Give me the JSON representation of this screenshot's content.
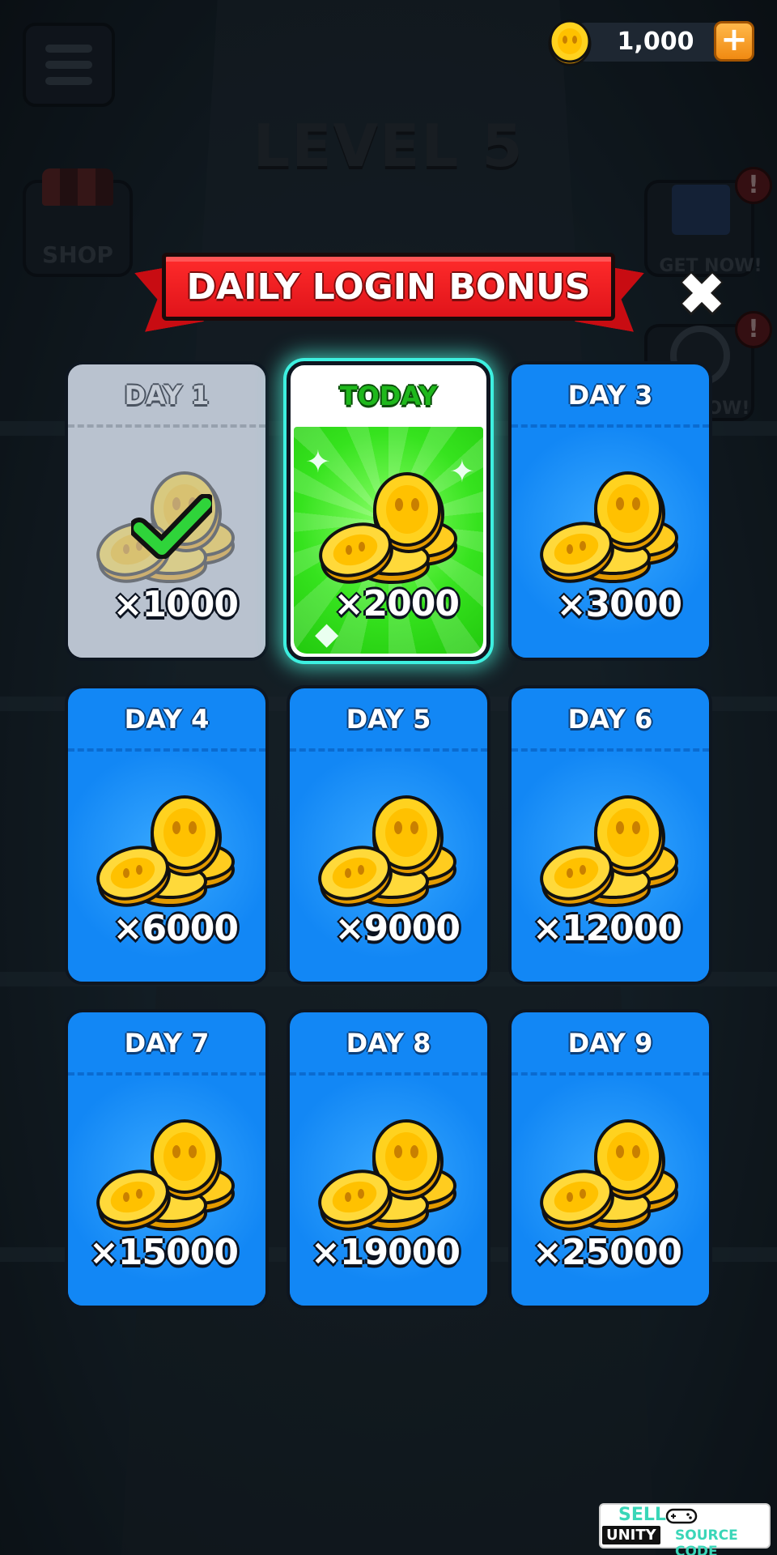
{
  "hud": {
    "coin_balance": "1,000",
    "level_title": "LEVEL 5",
    "shop_label": "SHOP",
    "gift_label": "GET NOW!",
    "wheel_label": "NOW!",
    "alert_symbol": "!",
    "plus_symbol": "+"
  },
  "popup": {
    "title": "DAILY LOGIN BONUS",
    "close_symbol": "✖"
  },
  "days": [
    {
      "label": "DAY 1",
      "amount": "×1000",
      "state": "claimed"
    },
    {
      "label": "TODAY",
      "amount": "×2000",
      "state": "today"
    },
    {
      "label": "DAY 3",
      "amount": "×3000",
      "state": "locked"
    },
    {
      "label": "DAY 4",
      "amount": "×6000",
      "state": "locked"
    },
    {
      "label": "DAY 5",
      "amount": "×9000",
      "state": "locked"
    },
    {
      "label": "DAY 6",
      "amount": "×12000",
      "state": "locked"
    },
    {
      "label": "DAY 7",
      "amount": "×15000",
      "state": "locked"
    },
    {
      "label": "DAY 8",
      "amount": "×19000",
      "state": "locked"
    },
    {
      "label": "DAY 9",
      "amount": "×25000",
      "state": "locked"
    }
  ],
  "watermark": {
    "line1": "SELL",
    "line2a": "UNITY",
    "line2b": "SOURCE CODE"
  },
  "colors": {
    "card_blue": "#1287f5",
    "card_claimed": "#b9c2cf",
    "today_green": "#36e31e",
    "banner_red": "#e0141a",
    "coin_gold": "#ffc21a"
  },
  "icons": {
    "menu": "hamburger-icon",
    "coin": "coin-icon",
    "claimed": "check-icon",
    "close": "close-icon",
    "reward": "coin-pile-icon"
  }
}
